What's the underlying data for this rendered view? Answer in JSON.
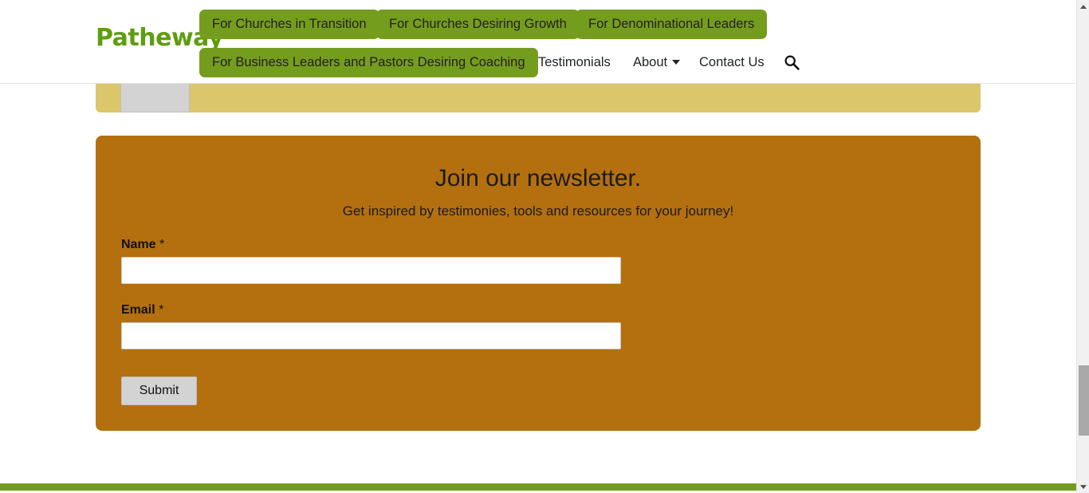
{
  "site": {
    "logo_text": "Patheway",
    "brand_green": "#749d1e",
    "panel_yellow": "#dcc66b",
    "panel_orange": "#b4700f"
  },
  "header": {
    "buttons": [
      {
        "id": "churches-transition",
        "label": "For Churches in Transition"
      },
      {
        "id": "churches-growth",
        "label": "For Churches Desiring Growth"
      },
      {
        "id": "denominational-leaders",
        "label": "For Denominational Leaders"
      },
      {
        "id": "business-leaders",
        "label": "For Business Leaders and Pastors Desiring Coaching"
      }
    ],
    "links": [
      {
        "id": "testimonials",
        "label": "Testimonials",
        "has_caret": false
      },
      {
        "id": "about",
        "label": "About",
        "has_caret": true
      },
      {
        "id": "contact",
        "label": "Contact Us",
        "has_caret": false
      }
    ],
    "search_icon": "search-icon"
  },
  "partial_panel": {
    "submit_label": ""
  },
  "newsletter": {
    "title": "Join our newsletter.",
    "subtitle": "Get inspired by testimonies, tools and resources for your journey!",
    "fields": [
      {
        "id": "name",
        "label": "Name",
        "required_mark": "*",
        "value": "",
        "placeholder": ""
      },
      {
        "id": "email",
        "label": "Email",
        "required_mark": "*",
        "value": "",
        "placeholder": ""
      }
    ],
    "submit_label": "Submit"
  },
  "scrollbar": {
    "up_arrow": "chevron-up-icon",
    "down_arrow": "chevron-down-icon"
  }
}
